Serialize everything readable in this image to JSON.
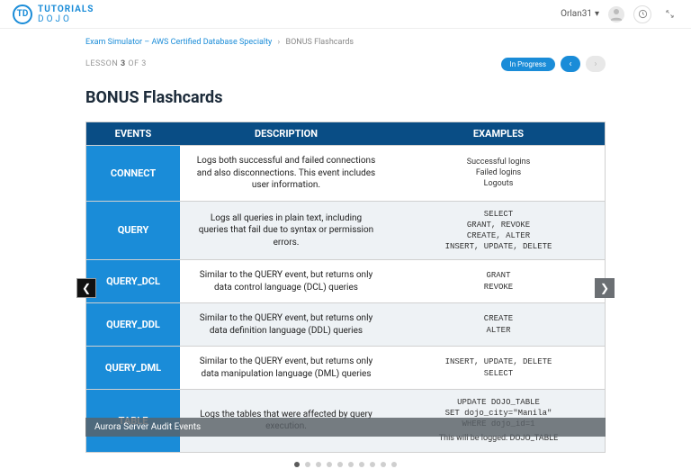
{
  "header": {
    "brand_top": "TUTORIALS",
    "brand_bottom": "DOJO",
    "brand_badge": "TD",
    "user": "Orlan31"
  },
  "breadcrumb": {
    "a": "Exam Simulator – AWS Certified Database Specialty",
    "b": "BONUS Flashcards"
  },
  "lesson": {
    "label_prefix": "LESSON ",
    "num": "3",
    "of": " OF 3",
    "status": "In Progress"
  },
  "title": "BONUS Flashcards",
  "table": {
    "h1": "EVENTS",
    "h2": "DESCRIPTION",
    "h3": "EXAMPLES",
    "rows": [
      {
        "ev": "CONNECT",
        "d": "Logs both successful and failed connections and also disconnections. This event includes user information.",
        "e": "Successful logins\nFailed logins\nLogouts",
        "mono": false
      },
      {
        "ev": "QUERY",
        "d": "Logs all queries in plain text, including queries that fail due to syntax or permission errors.",
        "e": "SELECT\nGRANT, REVOKE\nCREATE, ALTER\nINSERT, UPDATE, DELETE",
        "mono": true
      },
      {
        "ev": "QUERY_DCL",
        "d": "Similar to the QUERY event, but returns only data control language (DCL) queries",
        "e": "GRANT\nREVOKE",
        "mono": true
      },
      {
        "ev": "QUERY_DDL",
        "d": "Similar to the QUERY event, but returns only data definition language (DDL) queries",
        "e": "CREATE\nALTER",
        "mono": true
      },
      {
        "ev": "QUERY_DML",
        "d": "Similar to the QUERY event, but returns only data manipulation language (DML) queries",
        "e": "INSERT, UPDATE, DELETE\nSELECT",
        "mono": true
      },
      {
        "ev": "TABLE",
        "d": "Logs the tables that were affected by query execution.",
        "e": "UPDATE DOJO_TABLE\nSET dojo_city=\"Manila\"\nWHERE dojo_id=1",
        "mono": true,
        "note": "This will be logged: DOJO_TABLE"
      }
    ]
  },
  "caption": "Aurora Server Audit Events",
  "dots": {
    "count": 10,
    "active": 0
  }
}
